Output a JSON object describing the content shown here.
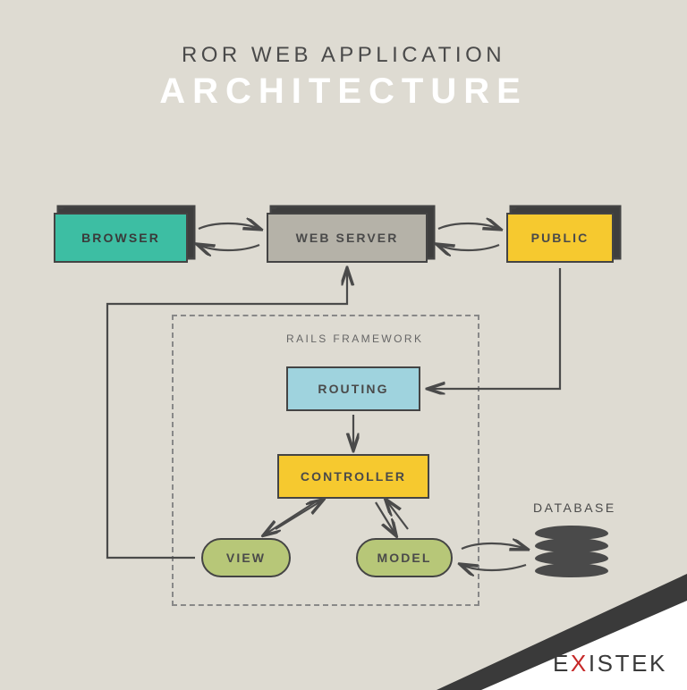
{
  "title": {
    "line1": "ROR WEB APPLICATION",
    "line2": "ARCHITECTURE"
  },
  "nodes": {
    "browser": "BROWSER",
    "web_server": "WEB SERVER",
    "public": "PUBLIC",
    "routing": "ROUTING",
    "controller": "CONTROLLER",
    "view": "VIEW",
    "model": "MODEL",
    "database": "DATABASE"
  },
  "framework_label": "RAILS FRAMEWORK",
  "brand": {
    "prefix": "E",
    "x": "X",
    "suffix": "ISTEK"
  },
  "colors": {
    "browser": "#3dbea3",
    "server": "#b5b2a8",
    "public": "#f6c92f",
    "routing": "#9fd3de",
    "controller": "#f6c92f",
    "view_model": "#b7c778",
    "stroke": "#4a4a4a"
  },
  "connections": [
    {
      "from": "browser",
      "to": "web_server",
      "type": "bidirectional"
    },
    {
      "from": "web_server",
      "to": "public",
      "type": "bidirectional"
    },
    {
      "from": "public",
      "to": "routing",
      "type": "unidirectional"
    },
    {
      "from": "routing",
      "to": "controller",
      "type": "unidirectional"
    },
    {
      "from": "controller",
      "to": "view",
      "type": "bidirectional"
    },
    {
      "from": "controller",
      "to": "model",
      "type": "bidirectional"
    },
    {
      "from": "model",
      "to": "database",
      "type": "bidirectional"
    },
    {
      "from": "view",
      "to": "web_server",
      "type": "unidirectional"
    }
  ]
}
